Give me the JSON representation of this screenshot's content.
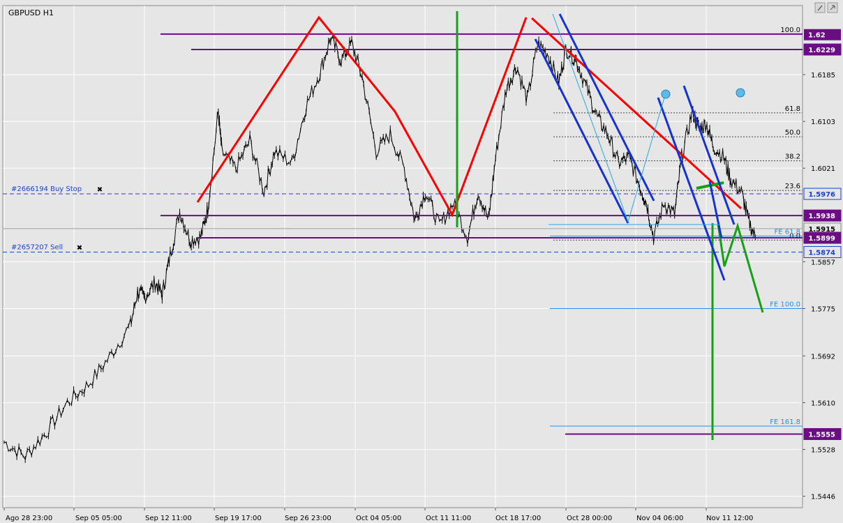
{
  "chart_data": {
    "type": "line",
    "title": "GBPUSD H1",
    "x_ticks": [
      "Ago 28 23:00",
      "Sep 05 05:00",
      "Sep 12 11:00",
      "Sep 19 17:00",
      "Sep 26 23:00",
      "Oct 04 05:00",
      "Oct 11 11:00",
      "Oct 18 17:00",
      "Oct 28 00:00",
      "Nov 04 06:00",
      "Nov 11 12:00"
    ],
    "y_ticks": [
      "1.6185",
      "1.6103",
      "1.6021",
      "1.5857",
      "1.5775",
      "1.5692",
      "1.5610",
      "1.5528",
      "1.5446"
    ],
    "ylim": [
      1.5426,
      1.6306
    ],
    "price_labels": [
      {
        "value": 1.6229,
        "text": "1.6229",
        "style": "purple"
      },
      {
        "value": 1.5976,
        "text": "1.5976",
        "style": "blue"
      },
      {
        "value": 1.5938,
        "text": "1.5938",
        "style": "purple"
      },
      {
        "value": 1.5915,
        "text": "1.5915",
        "style": "current"
      },
      {
        "value": 1.5899,
        "text": "1.5899",
        "style": "purple"
      },
      {
        "value": 1.5874,
        "text": "1.5874",
        "style": "blue"
      },
      {
        "value": 1.5555,
        "text": "1.5555",
        "style": "purple"
      }
    ],
    "badge_partial": {
      "value": 1.6255,
      "text": "1.62"
    },
    "fib_levels": [
      {
        "label": "100.0",
        "value": 1.6256
      },
      {
        "label": "61.8",
        "value": 1.6118
      },
      {
        "label": "50.0",
        "value": 1.6076
      },
      {
        "label": "38.2",
        "value": 1.6034
      },
      {
        "label": "23.6",
        "value": 1.5982
      },
      {
        "label": "0.0",
        "value": 1.5895
      }
    ],
    "fe_levels": [
      {
        "label": "FE 61.8",
        "value": 1.5902
      },
      {
        "label": "FE 100.0",
        "value": 1.5775
      },
      {
        "label": "FE 161.8",
        "value": 1.5569
      }
    ],
    "orders": [
      {
        "label": "#2666194 Buy Stop",
        "value": 1.5976
      },
      {
        "label": "#2657207 Sell",
        "value": 1.5874
      }
    ],
    "series": [
      {
        "anchors": [
          [
            0,
            1.5541
          ],
          [
            0.03,
            1.5516
          ],
          [
            0.06,
            1.5558
          ],
          [
            0.09,
            1.561
          ],
          [
            0.12,
            1.5642
          ],
          [
            0.15,
            1.569
          ],
          [
            0.18,
            1.5746
          ],
          [
            0.19,
            1.5804
          ],
          [
            0.2,
            1.5795
          ],
          [
            0.215,
            1.582
          ],
          [
            0.225,
            1.58
          ],
          [
            0.235,
            1.586
          ],
          [
            0.25,
            1.5945
          ],
          [
            0.265,
            1.5895
          ],
          [
            0.28,
            1.59
          ],
          [
            0.29,
            1.595
          ],
          [
            0.305,
            1.612
          ],
          [
            0.31,
            1.605
          ],
          [
            0.33,
            1.602
          ],
          [
            0.35,
            1.607
          ],
          [
            0.37,
            1.598
          ],
          [
            0.385,
            1.605
          ],
          [
            0.41,
            1.603
          ],
          [
            0.43,
            1.613
          ],
          [
            0.45,
            1.619
          ],
          [
            0.465,
            1.625
          ],
          [
            0.48,
            1.621
          ],
          [
            0.495,
            1.624
          ],
          [
            0.51,
            1.618
          ],
          [
            0.53,
            1.605
          ],
          [
            0.55,
            1.608
          ],
          [
            0.57,
            1.602
          ],
          [
            0.585,
            1.593
          ],
          [
            0.6,
            1.598
          ],
          [
            0.62,
            1.592
          ],
          [
            0.64,
            1.596
          ],
          [
            0.66,
            1.59
          ],
          [
            0.675,
            1.598
          ],
          [
            0.69,
            1.593
          ],
          [
            0.7,
            1.604
          ],
          [
            0.715,
            1.616
          ],
          [
            0.73,
            1.62
          ],
          [
            0.745,
            1.614
          ],
          [
            0.76,
            1.624
          ],
          [
            0.775,
            1.622
          ],
          [
            0.79,
            1.617
          ],
          [
            0.8,
            1.623
          ],
          [
            0.815,
            1.621
          ],
          [
            0.83,
            1.616
          ],
          [
            0.845,
            1.611
          ],
          [
            0.86,
            1.608
          ],
          [
            0.875,
            1.603
          ],
          [
            0.89,
            1.604
          ],
          [
            0.905,
            1.599
          ],
          [
            0.915,
            1.596
          ],
          [
            0.925,
            1.59
          ],
          [
            0.94,
            1.596
          ],
          [
            0.955,
            1.594
          ],
          [
            0.965,
            1.604
          ],
          [
            0.98,
            1.612
          ],
          [
            0.99,
            1.609
          ],
          [
            1.0,
            1.61
          ],
          [
            1.01,
            1.606
          ],
          [
            1.025,
            1.604
          ],
          [
            1.035,
            1.6
          ],
          [
            1.05,
            1.598
          ],
          [
            1.06,
            1.593
          ],
          [
            1.07,
            1.59
          ]
        ]
      }
    ]
  }
}
